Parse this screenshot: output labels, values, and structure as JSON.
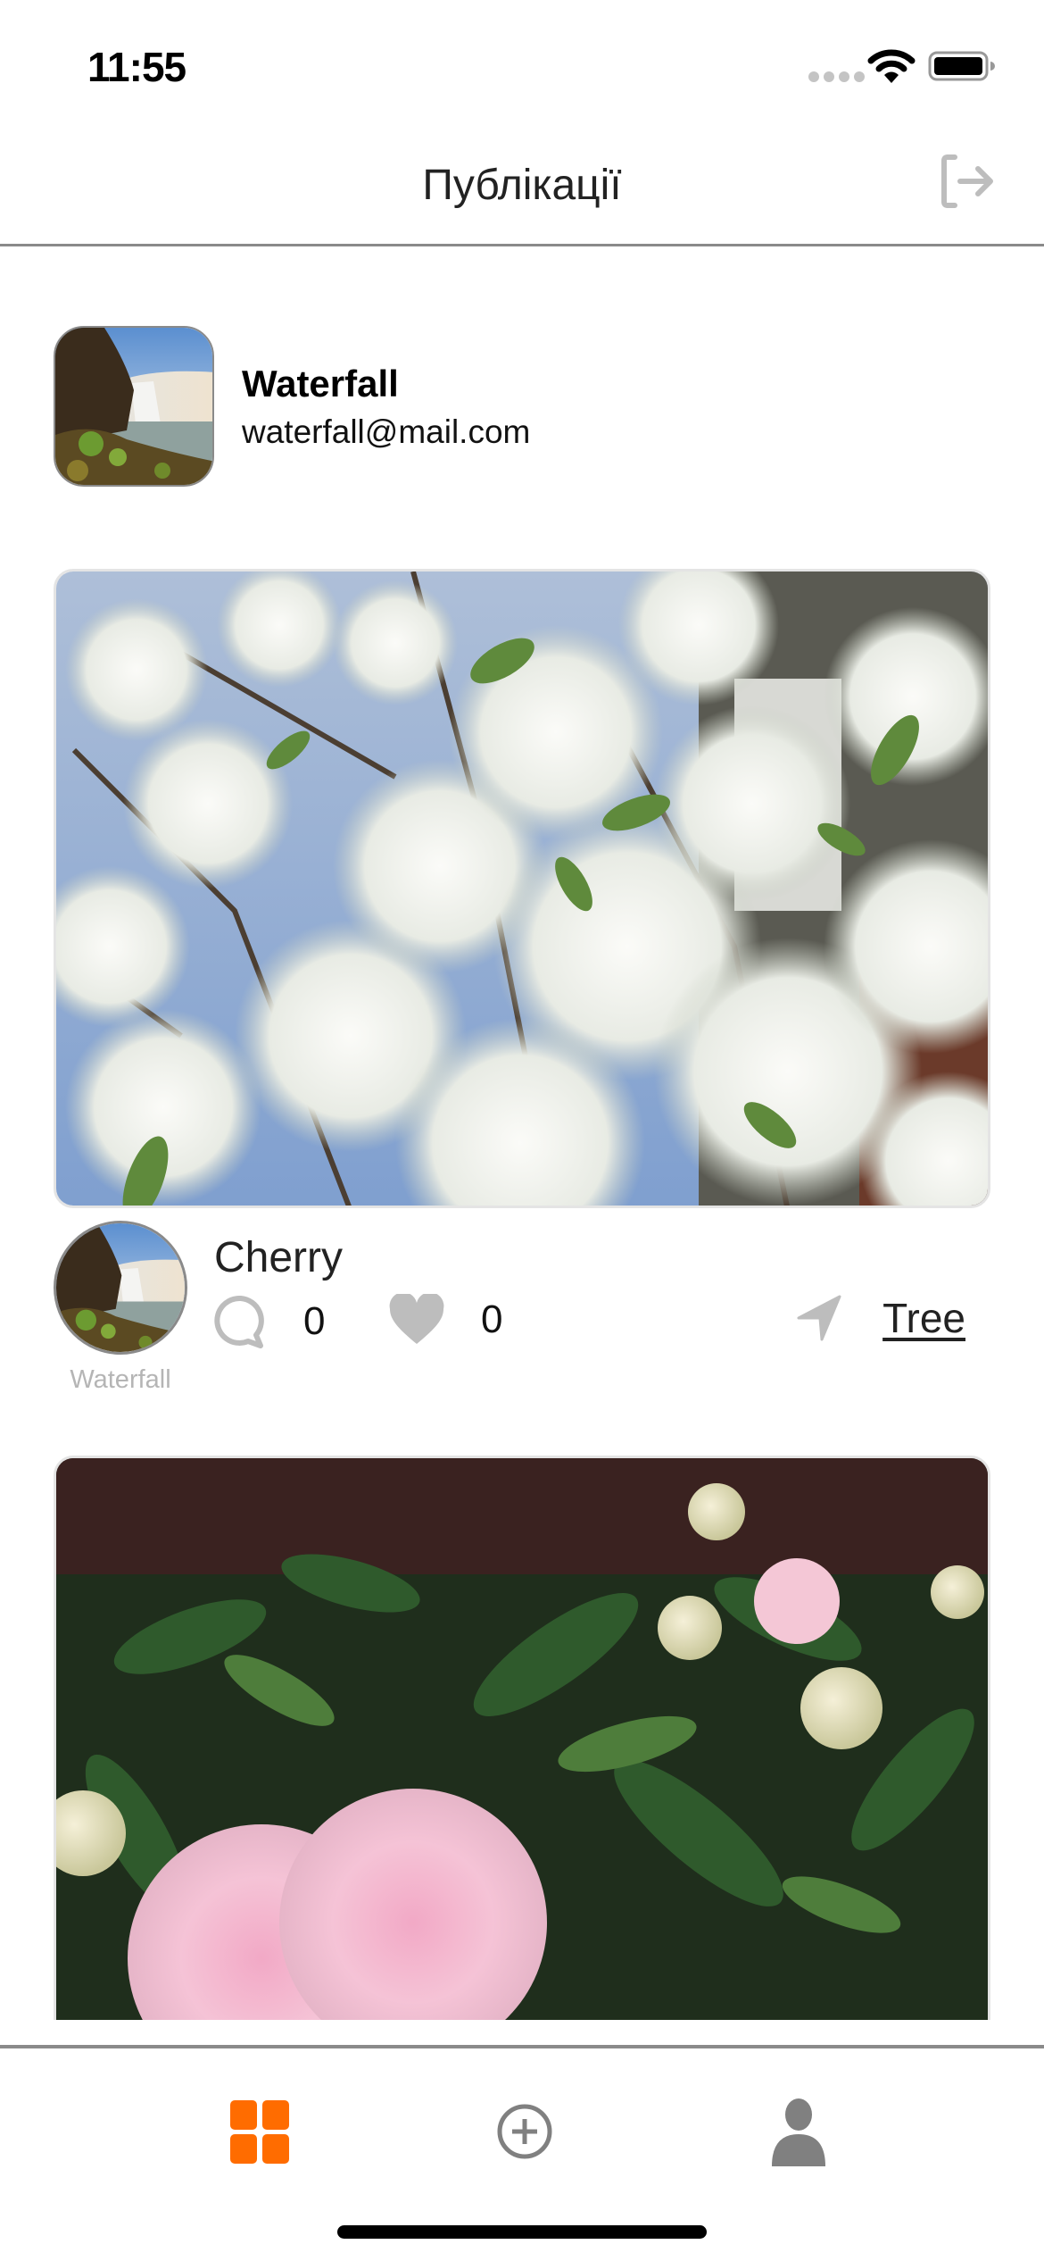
{
  "status_bar": {
    "time": "11:55",
    "icons": [
      "signal-dots-icon",
      "wifi-icon",
      "battery-icon"
    ]
  },
  "header": {
    "title": "Публікації",
    "right_icon": "logout-icon"
  },
  "profile": {
    "name": "Waterfall",
    "email": "waterfall@mail.com",
    "avatar": "waterfall-photo"
  },
  "posts": [
    {
      "image": "cherry-blossom-photo",
      "title": "Cherry",
      "author": "Waterfall",
      "author_avatar": "waterfall-photo",
      "comments": "0",
      "likes": "0",
      "location": "Tree"
    },
    {
      "image": "pink-peony-photo"
    }
  ],
  "tab_bar": {
    "items": [
      {
        "name": "posts",
        "icon": "grid-icon",
        "active": true
      },
      {
        "name": "create",
        "icon": "plus-circle-icon",
        "active": false
      },
      {
        "name": "profile",
        "icon": "user-icon",
        "active": false
      }
    ],
    "active_color": "#FF6C00",
    "inactive_color": "#808080"
  }
}
